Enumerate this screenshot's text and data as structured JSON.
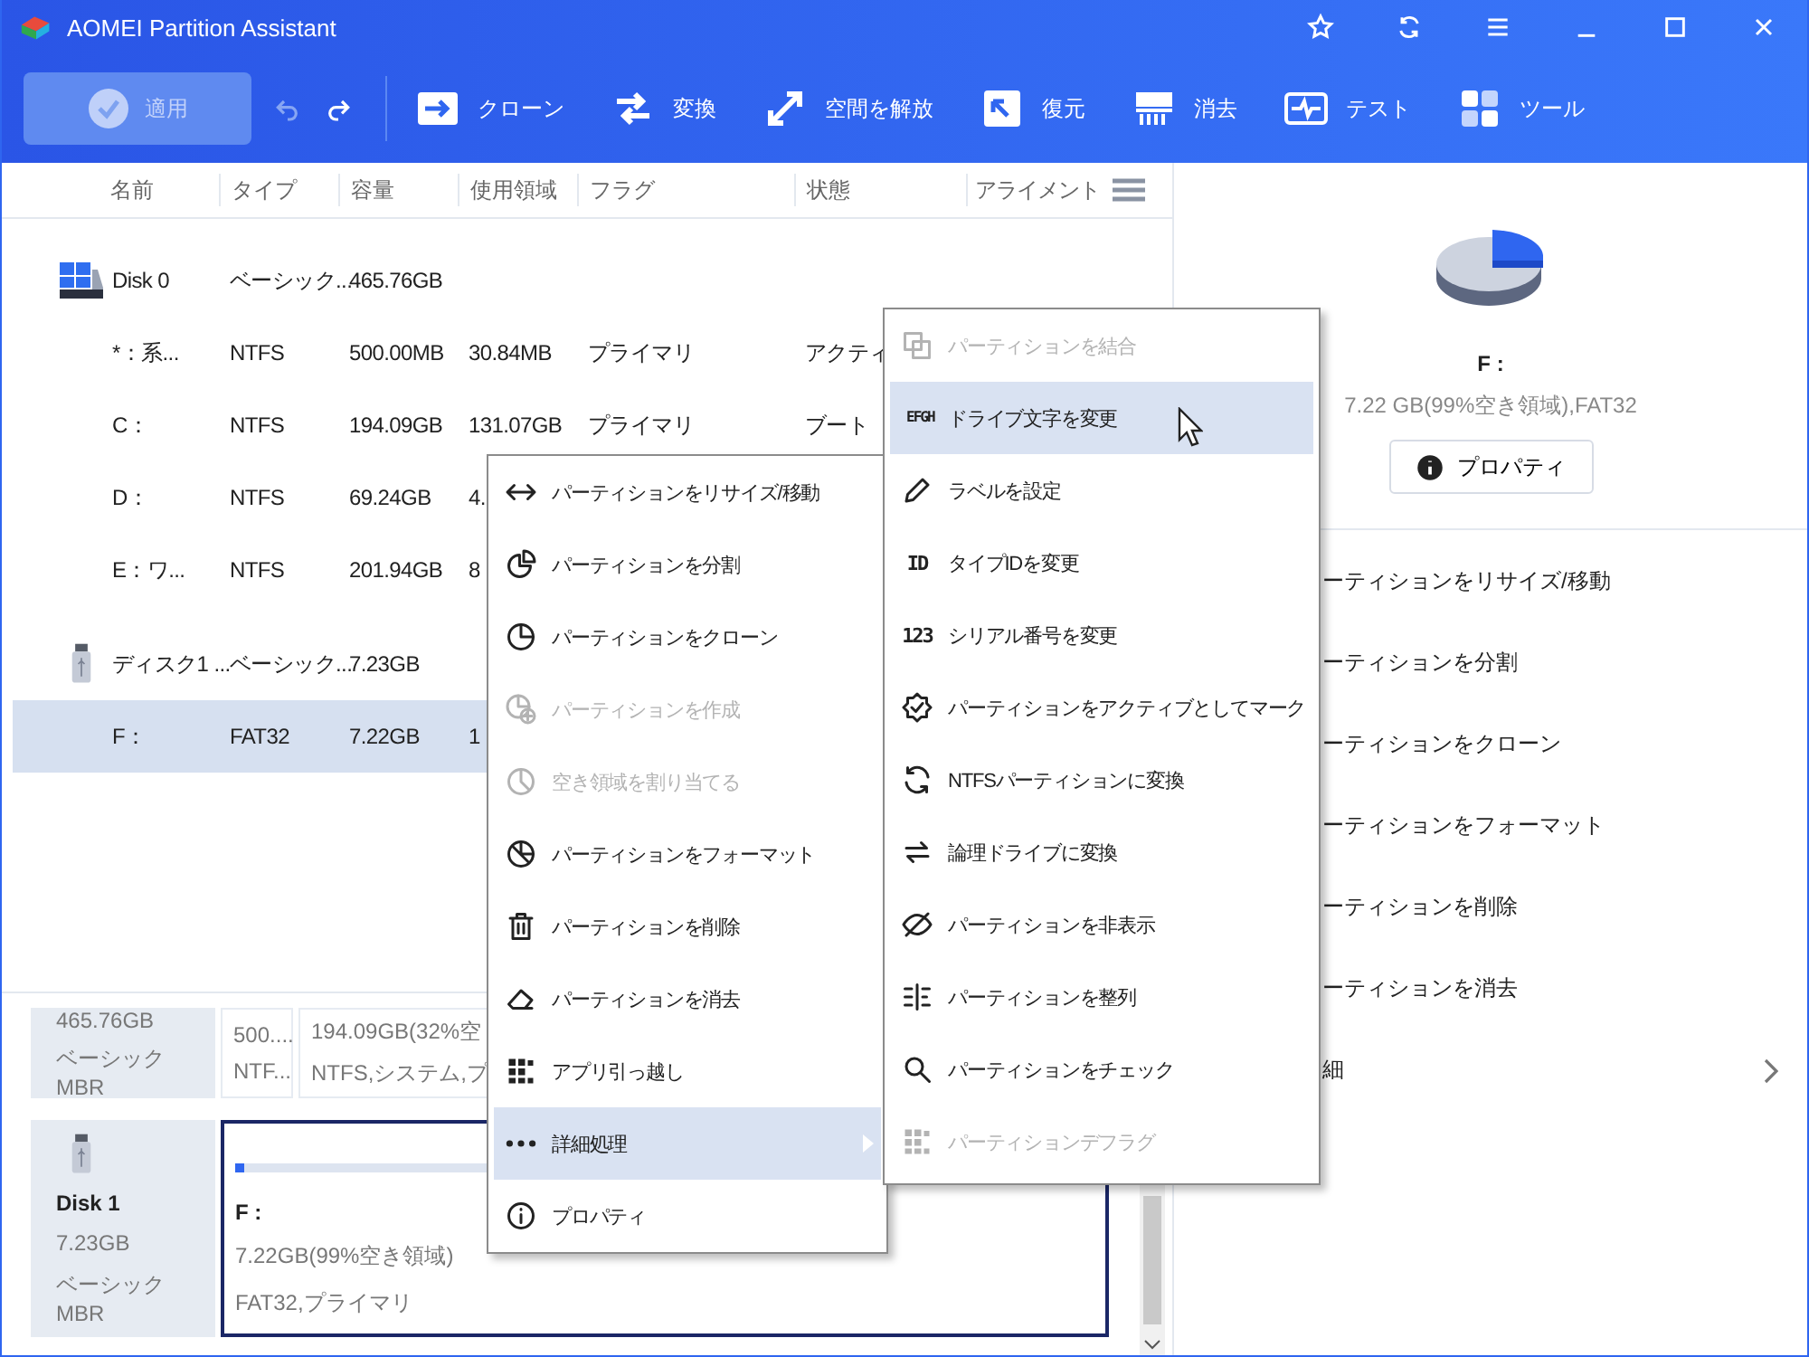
{
  "window": {
    "title": "AOMEI Partition Assistant"
  },
  "toolbar": {
    "apply": {
      "label": "適用",
      "disabled": true
    },
    "undo": {
      "disabled": true
    },
    "redo": {
      "disabled": false
    },
    "tools": [
      {
        "kind": "clone",
        "label": "クローン"
      },
      {
        "kind": "convert",
        "label": "変換"
      },
      {
        "kind": "free",
        "label": "空間を解放"
      },
      {
        "kind": "restore",
        "label": "復元"
      },
      {
        "kind": "wipe",
        "label": "消去"
      },
      {
        "kind": "test",
        "label": "テスト"
      },
      {
        "kind": "tools",
        "label": "ツール"
      }
    ]
  },
  "table": {
    "columns": [
      "名前",
      "タイプ",
      "容量",
      "使用領域",
      "フラグ",
      "状態",
      "アライメント"
    ],
    "rows": [
      {
        "kind": "hdd_disk",
        "selected": false,
        "cells": [
          "Disk 0",
          "ベーシック...",
          "465.76GB"
        ]
      },
      {
        "kind": "partition",
        "selected": false,
        "cells": [
          "*：系...",
          "NTFS",
          "500.00MB",
          "30.84MB",
          "プライマリ",
          "アクティ"
        ]
      },
      {
        "kind": "partition",
        "selected": false,
        "cells": [
          "C：",
          "NTFS",
          "194.09GB",
          "131.07GB",
          "プライマリ",
          "ブート"
        ]
      },
      {
        "kind": "partition",
        "selected": false,
        "cells": [
          "D：",
          "NTFS",
          "69.24GB",
          "4."
        ]
      },
      {
        "kind": "partition",
        "selected": false,
        "cells": [
          "E：ワ...",
          "NTFS",
          "201.94GB",
          "8"
        ]
      },
      {
        "kind": "usb_disk",
        "selected": false,
        "cells": [
          "ディスク1 ...",
          "ベーシック...",
          "7.23GB"
        ]
      },
      {
        "kind": "partition",
        "selected": true,
        "cells": [
          "F：",
          "FAT32",
          "7.22GB",
          "1"
        ]
      }
    ]
  },
  "disk_map": [
    {
      "kind": "hdd_disk",
      "size": "465.76GB",
      "type": "ベーシック MBR",
      "partitions": [
        {
          "lines": [
            "500....",
            "NTF..."
          ],
          "selected": false
        },
        {
          "lines": [
            "194.09GB(32%空",
            "NTFS,システム,プ"
          ],
          "selected": false
        }
      ]
    },
    {
      "kind": "usb_disk",
      "name": "Disk 1",
      "size": "7.23GB",
      "type": "ベーシック MBR",
      "partitions": [
        {
          "title": "F :",
          "lines": [
            "7.22GB(99%空き領域)",
            "FAT32,プライマリ"
          ],
          "selected": true,
          "level": 0.01
        }
      ]
    }
  ],
  "details": {
    "name": "F :",
    "summary": "7.22 GB(99%空き領域),FAT32",
    "button": "プロパティ",
    "actions": [
      {
        "label": "ーティションをリサイズ/移動",
        "has_submenu": false
      },
      {
        "label": "ーティションを分割",
        "has_submenu": false
      },
      {
        "label": "ーティションをクローン",
        "has_submenu": false
      },
      {
        "label": "ーティションをフォーマット",
        "has_submenu": false
      },
      {
        "label": "ーティションを削除",
        "has_submenu": false
      },
      {
        "label": "ーティションを消去",
        "has_submenu": false
      },
      {
        "label": "細",
        "has_submenu": true
      }
    ]
  },
  "context_menu": {
    "items": [
      {
        "label": "パーティションをリサイズ/移動",
        "disabled": false,
        "selected": false,
        "has_submenu": false
      },
      {
        "label": "パーティションを分割",
        "disabled": false,
        "selected": false,
        "has_submenu": false
      },
      {
        "label": "パーティションをクローン",
        "disabled": false,
        "selected": false,
        "has_submenu": false
      },
      {
        "label": "パーティションを作成",
        "disabled": true,
        "selected": false,
        "has_submenu": false
      },
      {
        "label": "空き領域を割り当てる",
        "disabled": true,
        "selected": false,
        "has_submenu": false
      },
      {
        "label": "パーティションをフォーマット",
        "disabled": false,
        "selected": false,
        "has_submenu": false
      },
      {
        "label": "パーティションを削除",
        "disabled": false,
        "selected": false,
        "has_submenu": false
      },
      {
        "label": "パーティションを消去",
        "disabled": false,
        "selected": false,
        "has_submenu": false
      },
      {
        "label": "アプリ引っ越し",
        "disabled": false,
        "selected": false,
        "has_submenu": false
      },
      {
        "label": "詳細処理",
        "disabled": false,
        "selected": true,
        "has_submenu": true
      },
      {
        "label": "プロパティ",
        "disabled": false,
        "selected": false,
        "has_submenu": false
      }
    ]
  },
  "submenu": {
    "items": [
      {
        "label": "パーティションを結合",
        "disabled": true,
        "selected": false
      },
      {
        "glyph": "EFGH",
        "label": "ドライブ文字を変更",
        "disabled": false,
        "selected": true
      },
      {
        "label": "ラベルを設定",
        "disabled": false,
        "selected": false
      },
      {
        "glyph": "ID",
        "label": "タイプIDを変更",
        "disabled": false,
        "selected": false
      },
      {
        "glyph": "123",
        "label": "シリアル番号を変更",
        "disabled": false,
        "selected": false
      },
      {
        "label": "パーティションをアクティブとしてマーク",
        "disabled": false,
        "selected": false
      },
      {
        "label": "NTFSパーティションに変換",
        "disabled": false,
        "selected": false
      },
      {
        "label": "論理ドライブに変換",
        "disabled": false,
        "selected": false
      },
      {
        "label": "パーティションを非表示",
        "disabled": false,
        "selected": false
      },
      {
        "label": "パーティションを整列",
        "disabled": false,
        "selected": false
      },
      {
        "label": "パーティションをチェック",
        "disabled": false,
        "selected": false
      },
      {
        "label": "パーティションデフラグ",
        "disabled": true,
        "selected": false
      }
    ]
  }
}
